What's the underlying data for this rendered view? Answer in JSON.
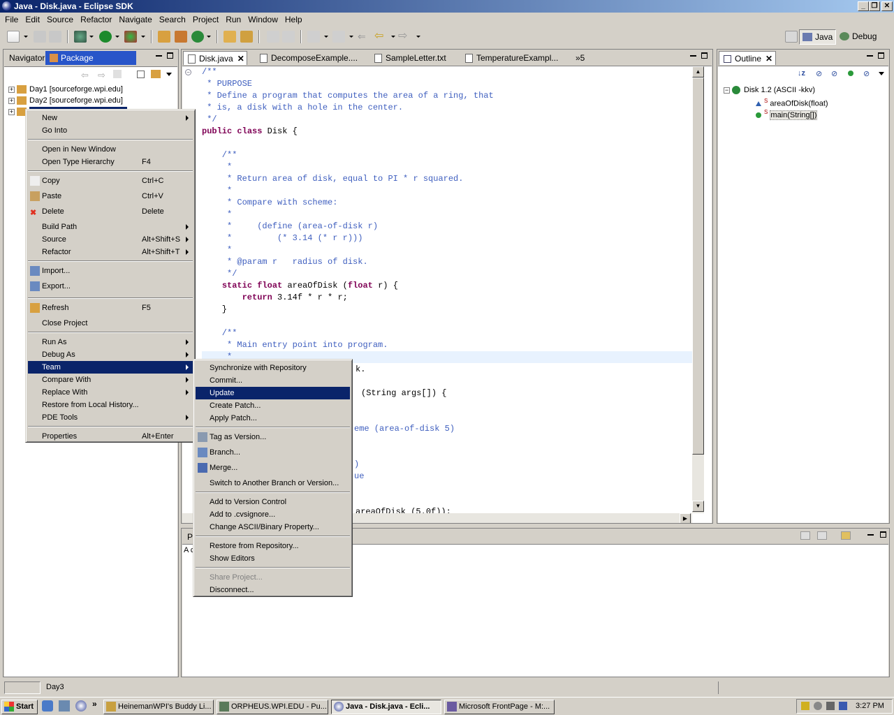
{
  "window": {
    "title": "Java - Disk.java - Eclipse SDK"
  },
  "menubar": [
    "File",
    "Edit",
    "Source",
    "Refactor",
    "Navigate",
    "Search",
    "Project",
    "Run",
    "Window",
    "Help"
  ],
  "perspectives": {
    "java": "Java",
    "debug": "Debug"
  },
  "left_panel": {
    "tabs": [
      "Navigator",
      "Package Explorer"
    ],
    "tree": [
      "Day1  [sourceforge.wpi.edu]",
      "Day2  [sourceforge.wpi.edu]"
    ]
  },
  "editor": {
    "tabs": [
      "Disk.java",
      "DecomposeExample....",
      "SampleLetter.txt",
      "TemperatureExampl..."
    ],
    "overflow": "»5",
    "lines": [
      {
        "t": "/**",
        "c": "cmt"
      },
      {
        "t": " * PURPOSE",
        "c": "cmt"
      },
      {
        "t": " * Define a program that computes the area of a ring, that",
        "c": "cmt"
      },
      {
        "t": " * is, a disk with a hole in the center.",
        "c": "cmt"
      },
      {
        "t": " */",
        "c": "cmt"
      },
      {
        "t": "public class Disk {",
        "c": "mix1"
      },
      {
        "t": "",
        "c": ""
      },
      {
        "t": "    /**",
        "c": "cmt"
      },
      {
        "t": "     *",
        "c": "cmt"
      },
      {
        "t": "     * Return area of disk, equal to PI * r squared.",
        "c": "cmt"
      },
      {
        "t": "     *",
        "c": "cmt"
      },
      {
        "t": "     * Compare with scheme:",
        "c": "cmt"
      },
      {
        "t": "     *",
        "c": "cmt"
      },
      {
        "t": "     *     (define (area-of-disk r)",
        "c": "cmt"
      },
      {
        "t": "     *         (* 3.14 (* r r)))",
        "c": "cmt"
      },
      {
        "t": "     *",
        "c": "cmt"
      },
      {
        "t": "     * @param r   radius of disk.",
        "c": "cmt"
      },
      {
        "t": "     */",
        "c": "cmt"
      },
      {
        "t": "    static float areaOfDisk (float r) {",
        "c": "mix2"
      },
      {
        "t": "        return 3.14f * r * r;",
        "c": "mix3"
      },
      {
        "t": "    }",
        "c": ""
      },
      {
        "t": "",
        "c": ""
      },
      {
        "t": "    /**",
        "c": "cmt"
      },
      {
        "t": "     * Main entry point into program.",
        "c": "cmt"
      },
      {
        "t": "     *",
        "c": "cmt"
      }
    ],
    "hidden_fragments": [
      "k.",
      "(String args[]) {",
      "eme (area-of-disk 5)",
      ")",
      "ue",
      "areaOfDisk (5.0f));"
    ]
  },
  "outline": {
    "tab": "Outline",
    "items": [
      "Disk  1.2  (ASCII -kkv)",
      "areaOfDisk(float)",
      "main(String[])"
    ]
  },
  "bottom": {
    "tab": "Pro",
    "text": "A c"
  },
  "context_menu": [
    {
      "label": "New",
      "sub": true
    },
    {
      "label": "Go Into"
    },
    {
      "sep": true
    },
    {
      "label": "Open in New Window"
    },
    {
      "label": "Open Type Hierarchy",
      "acc": "F4"
    },
    {
      "sep": true
    },
    {
      "label": "Copy",
      "acc": "Ctrl+C",
      "icon": "copy"
    },
    {
      "label": "Paste",
      "acc": "Ctrl+V",
      "icon": "paste"
    },
    {
      "label": "Delete",
      "acc": "Delete",
      "icon": "delete"
    },
    {
      "label": "Build Path",
      "sub": true
    },
    {
      "label": "Source",
      "acc": "Alt+Shift+S",
      "sub": true
    },
    {
      "label": "Refactor",
      "acc": "Alt+Shift+T",
      "sub": true
    },
    {
      "sep": true
    },
    {
      "label": "Import...",
      "icon": "import"
    },
    {
      "label": "Export...",
      "icon": "export"
    },
    {
      "sep": true
    },
    {
      "label": "Refresh",
      "acc": "F5",
      "icon": "refresh"
    },
    {
      "label": "Close Project"
    },
    {
      "sep": true
    },
    {
      "label": "Run As",
      "sub": true
    },
    {
      "label": "Debug As",
      "sub": true
    },
    {
      "label": "Team",
      "sub": true,
      "hl": true
    },
    {
      "label": "Compare With",
      "sub": true
    },
    {
      "label": "Replace With",
      "sub": true
    },
    {
      "label": "Restore from Local History..."
    },
    {
      "label": "PDE Tools",
      "sub": true
    },
    {
      "sep": true
    },
    {
      "label": "Properties",
      "acc": "Alt+Enter"
    }
  ],
  "team_menu": [
    {
      "label": "Synchronize with Repository"
    },
    {
      "label": "Commit..."
    },
    {
      "label": "Update",
      "hl": true
    },
    {
      "label": "Create Patch..."
    },
    {
      "label": "Apply Patch..."
    },
    {
      "sep": true
    },
    {
      "label": "Tag as Version...",
      "icon": "tag"
    },
    {
      "label": "Branch...",
      "icon": "branch"
    },
    {
      "label": "Merge...",
      "icon": "merge"
    },
    {
      "label": "Switch to Another Branch or Version..."
    },
    {
      "sep": true
    },
    {
      "label": "Add to Version Control"
    },
    {
      "label": "Add to .cvsignore..."
    },
    {
      "label": "Change ASCII/Binary Property..."
    },
    {
      "sep": true
    },
    {
      "label": "Restore from Repository..."
    },
    {
      "label": "Show Editors"
    },
    {
      "sep": true
    },
    {
      "label": "Share Project...",
      "dis": true
    },
    {
      "label": "Disconnect..."
    }
  ],
  "statusbar": {
    "text": "Day3"
  },
  "taskbar": {
    "start": "Start",
    "tasks": [
      "HeinemanWPI's Buddy Li...",
      "ORPHEUS.WPI.EDU - Pu...",
      "Java - Disk.java - Ecli...",
      "Microsoft FrontPage - M:..."
    ],
    "clock": "3:27 PM"
  }
}
